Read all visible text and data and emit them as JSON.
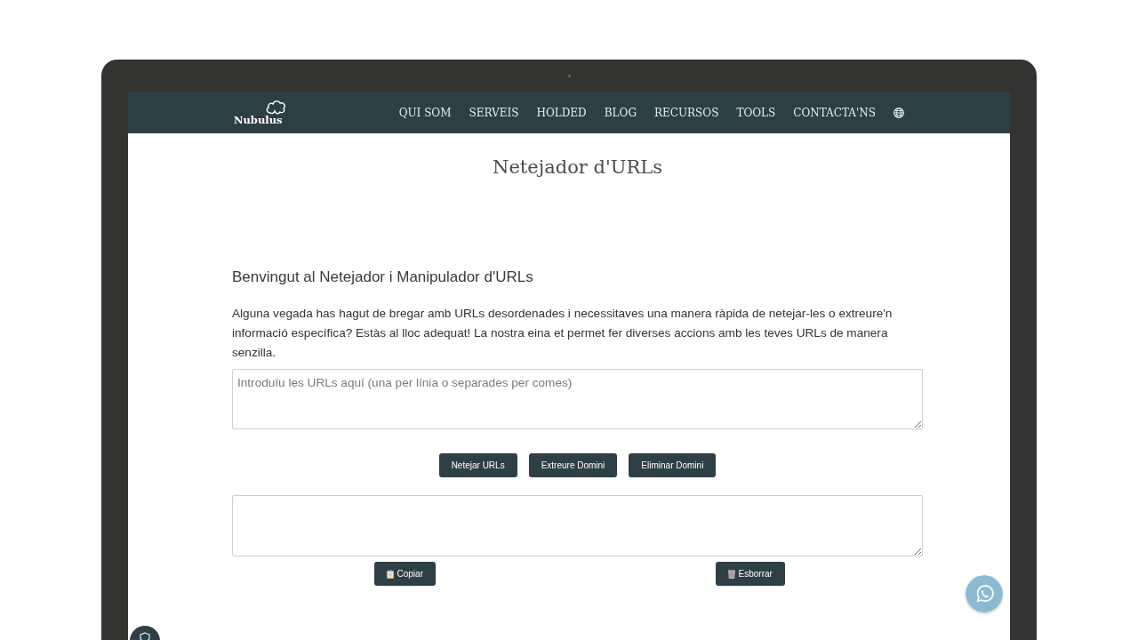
{
  "logo": {
    "name": "Nubulus"
  },
  "nav": {
    "items": [
      "QUI SOM",
      "SERVEIS",
      "HOLDED",
      "BLOG",
      "RECURSOS",
      "TOOLS",
      "CONTACTA'NS"
    ]
  },
  "page_title": "Netejador d'URLs",
  "intro": {
    "heading": "Benvingut al Netejador i Manipulador d'URLs",
    "text": "Alguna vegada has hagut de bregar amb URLs desordenades i necessitaves una manera ràpida de netejar-les o extreure'n informació específica? Estàs al lloc adequat! La nostra eina et permet fer diverses accions amb les teves URLs de manera senzilla."
  },
  "url_input": {
    "placeholder": "Introduïu les URLs aquí (una per línia o separades per comes)"
  },
  "actions": [
    "Netejar URLs",
    "Extreure Domini",
    "Eliminar Domini"
  ],
  "output_actions": [
    {
      "kind": "copy",
      "label": "Copiar"
    },
    {
      "kind": "clear",
      "label": "Esborrar"
    }
  ]
}
